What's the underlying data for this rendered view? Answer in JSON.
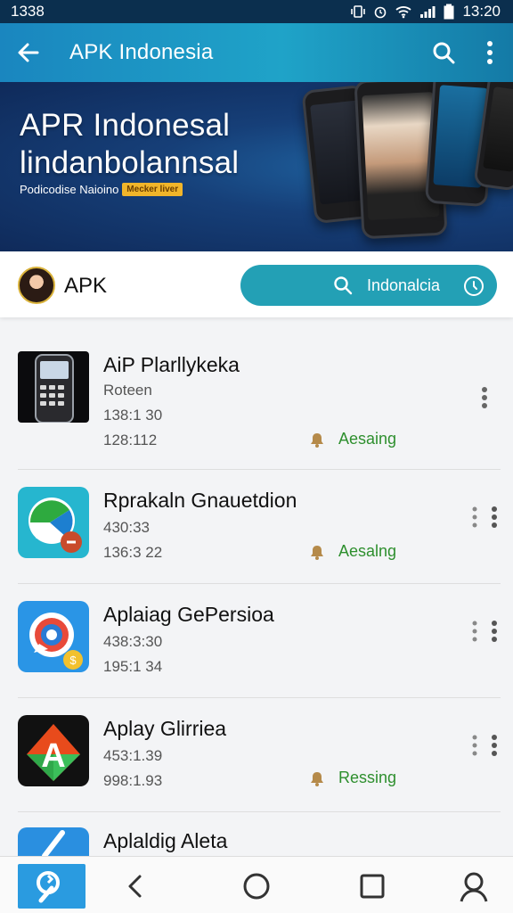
{
  "status_bar": {
    "time_left": "1338",
    "time_right": "13:20"
  },
  "app_bar": {
    "title": "APK Indonesia"
  },
  "banner": {
    "headline_1": "APR Indonesal",
    "headline_2": "lindanbolannsal",
    "tagline": "Podicodise Naioino",
    "badge": "Mecker liver"
  },
  "search_strip": {
    "brand": "APK",
    "search_label": "Indonalcia"
  },
  "apps": [
    {
      "name": "AiP Plarllykeka",
      "line1": "Roteen",
      "line2": "138:1 30",
      "line3": "128:112",
      "status": "Aesaing"
    },
    {
      "name": "Rprakaln Gnauetdion",
      "line1": "430:33",
      "line2": "136:3 22",
      "status": "Aesalng"
    },
    {
      "name": "Aplaiag GePersioa",
      "line1": "438:3:30",
      "line2": "195:1 34",
      "status": ""
    },
    {
      "name": "Aplay Glirriea",
      "line1": "453:1.39",
      "line2": "998:1.93",
      "status": "Ressing"
    },
    {
      "name": "Aplaldig Aleta"
    }
  ],
  "colors": {
    "accent": "#23a0b5",
    "status_green": "#2e8f2e",
    "app_bar": "#1a86bf"
  }
}
